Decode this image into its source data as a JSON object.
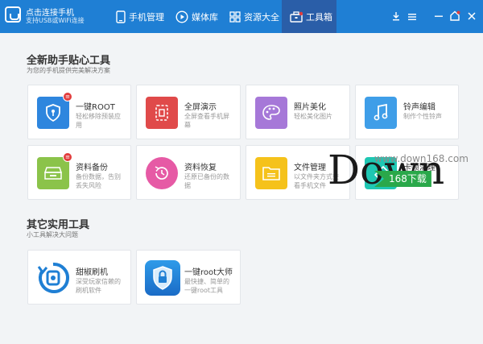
{
  "header": {
    "app_title": "点击连接手机",
    "app_subtitle": "支持USB或WiFi连接",
    "tabs": [
      {
        "label": "手机管理",
        "icon": "phone-icon"
      },
      {
        "label": "媒体库",
        "icon": "play-icon"
      },
      {
        "label": "资源大全",
        "icon": "grid-icon"
      },
      {
        "label": "工具箱",
        "icon": "toolbox-icon",
        "active": true
      }
    ],
    "controls": [
      "download-icon",
      "menu-icon",
      "minimize-icon",
      "home-icon",
      "close-icon"
    ]
  },
  "section1": {
    "title": "全新助手贴心工具",
    "subtitle": "为您的手机提供完美解决方案",
    "tools": [
      {
        "name": "一键ROOT",
        "desc": "轻松移除预装应用",
        "icon": "shield-icon",
        "color": "#2e86de",
        "badge": true
      },
      {
        "name": "全屏演示",
        "desc": "全屏查看手机屏幕",
        "icon": "screen-cast-icon",
        "color": "#e04a4a"
      },
      {
        "name": "照片美化",
        "desc": "轻松美化图片",
        "icon": "palette-icon",
        "color": "#a678d8"
      },
      {
        "name": "铃声编辑",
        "desc": "制作个性铃声",
        "icon": "music-note-icon",
        "color": "#3f9ee8"
      },
      {
        "name": "资料备份",
        "desc": "备份数据，告别丢失风险",
        "icon": "backup-drive-icon",
        "color": "#8bc34a",
        "badge": true
      },
      {
        "name": "资料恢复",
        "desc": "还原已备份的数据",
        "icon": "restore-clock-icon",
        "color": "#e65aa5"
      },
      {
        "name": "文件管理",
        "desc": "以文件夹方式查看手机文件",
        "icon": "folder-icon",
        "color": "#f5c21b"
      },
      {
        "name": "卡帧清理",
        "desc": "清理",
        "icon": "clean-icon",
        "color": "#1fc7b3"
      }
    ]
  },
  "section2": {
    "title": "其它实用工具",
    "subtitle": "小工具解决大问题",
    "tools": [
      {
        "name": "甜椒刷机",
        "desc": "深受玩家信赖的刷机软件",
        "icon": "flash-rom-icon",
        "color": "#1f7fd4"
      },
      {
        "name": "一键root大师",
        "desc": "最快捷、简单的一键root工具",
        "icon": "root-master-icon",
        "color": "#1f7fd4"
      }
    ]
  },
  "watermark": {
    "big": "Down",
    "url": "www.down168.com",
    "tag": "168下载"
  }
}
